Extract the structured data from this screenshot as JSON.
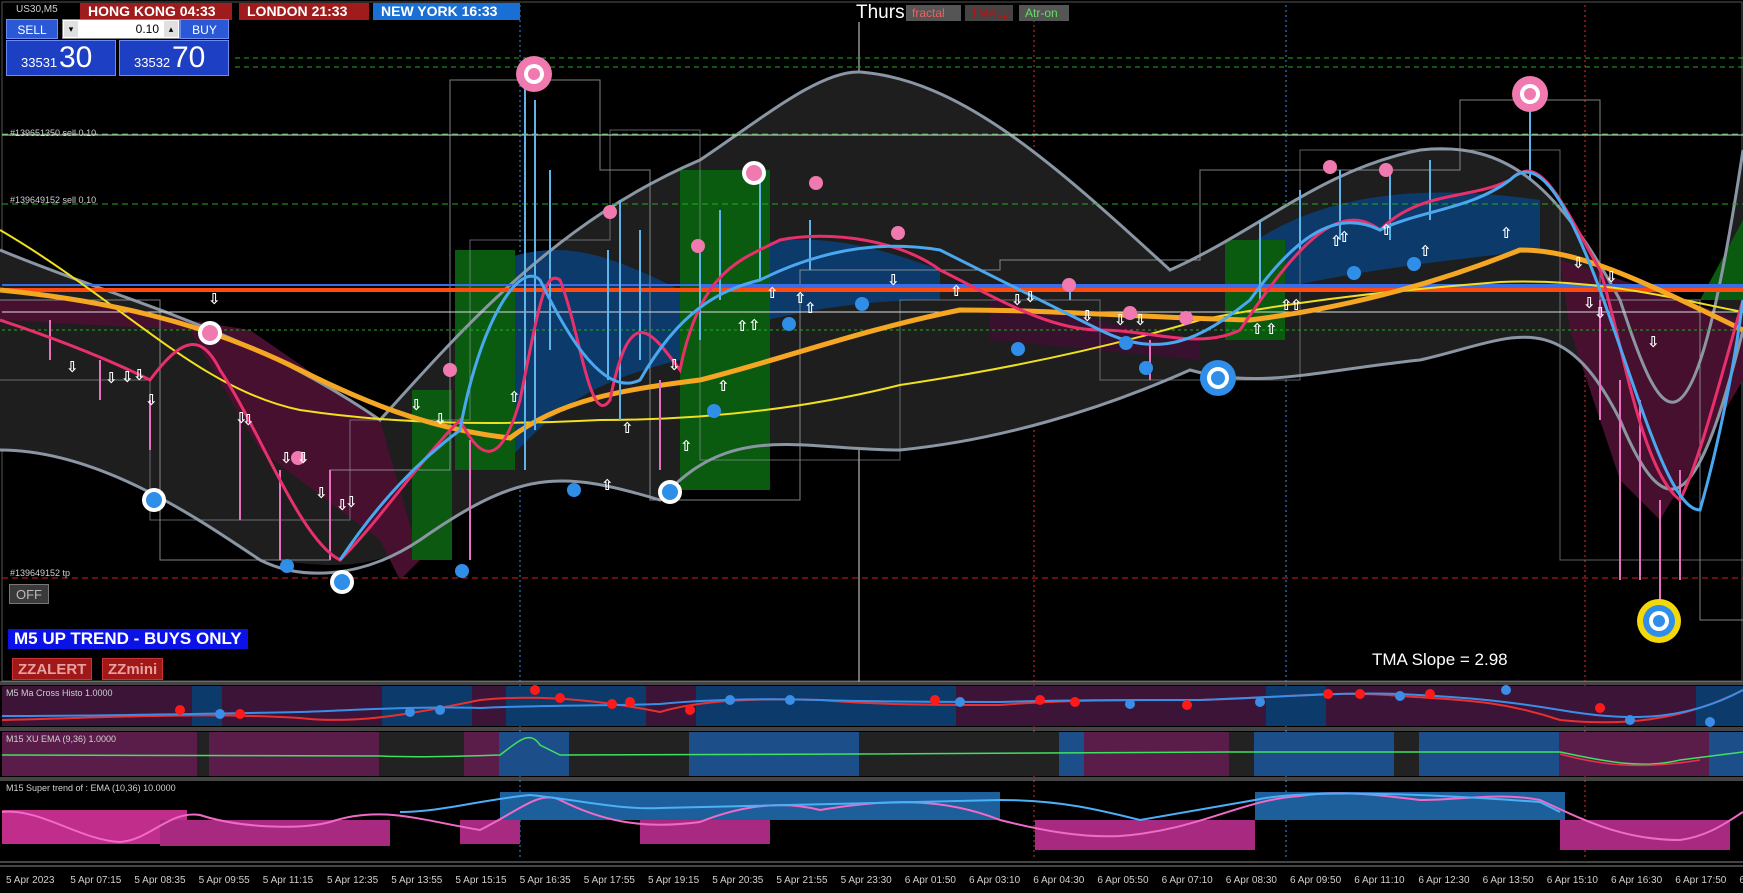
{
  "symbol": "US30,M5",
  "clocks": [
    {
      "city": "HONG KONG",
      "time": "04:33",
      "color": "#a01c1c"
    },
    {
      "city": "LONDON",
      "time": "21:33",
      "color": "#a01c1c"
    },
    {
      "city": "NEW YORK",
      "time": "16:33",
      "color": "#1a6fd4"
    }
  ],
  "trade": {
    "sell_label": "SELL",
    "buy_label": "BUY",
    "lot": "0.10",
    "down_arrow": "▾",
    "up_arrow": "▴",
    "bid_small": "33531",
    "bid_big": "30",
    "ask_small": "33532",
    "ask_big": "70"
  },
  "day_label": "Thurs",
  "tags": [
    {
      "label": "fractal",
      "color": "#f06060"
    },
    {
      "label": "TMAcg",
      "color": "#c01010"
    },
    {
      "label": "Atr-on",
      "color": "#60e060"
    }
  ],
  "order_labels": [
    {
      "text": "#139651350 sell 0.10"
    },
    {
      "text": "#139649152 sell 0.10"
    },
    {
      "text": "#139649152 tp"
    }
  ],
  "off_button": "OFF",
  "trend_banner": "M5 UP TREND - BUYS ONLY",
  "zz_buttons": [
    "ZZALERT",
    "ZZmini"
  ],
  "tma_slope": "TMA Slope = 2.98",
  "subwindows": [
    "M5 Ma Cross Histo 1.0000",
    "M15 XU EMA (9,36) 1.0000",
    "M15  Super trend of : EMA (10,36)  10.0000"
  ],
  "time_axis": [
    "5 Apr 2023",
    "5 Apr 07:15",
    "5 Apr 08:35",
    "5 Apr 09:55",
    "5 Apr 11:15",
    "5 Apr 12:35",
    "5 Apr 13:55",
    "5 Apr 15:15",
    "5 Apr 16:35",
    "5 Apr 17:55",
    "5 Apr 19:15",
    "5 Apr 20:35",
    "5 Apr 21:55",
    "5 Apr 23:30",
    "6 Apr 01:50",
    "6 Apr 03:10",
    "6 Apr 04:30",
    "6 Apr 05:50",
    "6 Apr 07:10",
    "6 Apr 08:30",
    "6 Apr 09:50",
    "6 Apr 11:10",
    "6 Apr 12:30",
    "6 Apr 13:50",
    "6 Apr 15:10",
    "6 Apr 16:30",
    "6 Apr 17:50",
    "6 Apr 1"
  ],
  "colors": {
    "upper_band": "#7f8c99",
    "tma_fast": "#e8306c",
    "tma_blue": "#2e7de0",
    "ma_orange": "#f5a623",
    "ma_yellow": "#f0e020",
    "level_orange": "#ff4a10",
    "level_blue": "#3a6ee8"
  }
}
